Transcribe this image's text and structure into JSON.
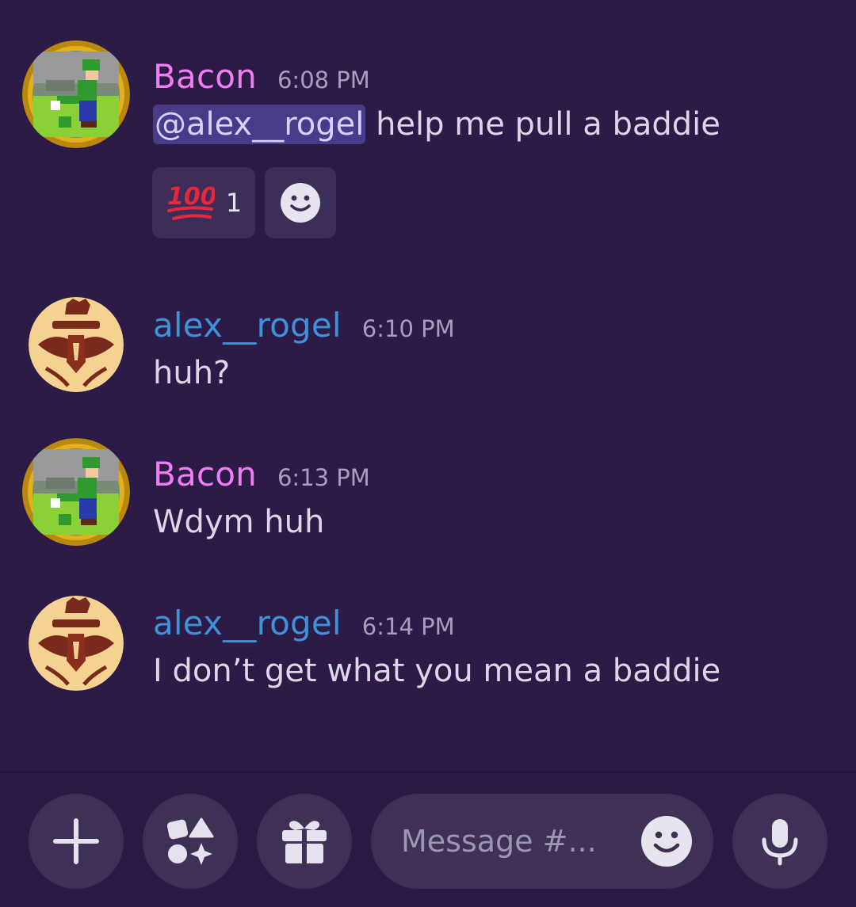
{
  "messages": [
    {
      "author": "Bacon",
      "author_color": "#f17df3",
      "time": "6:08 PM",
      "mention": "@alex__rogel",
      "text": " help me pull a baddie",
      "reactions": [
        {
          "emoji": "100-emoji",
          "count": "1"
        }
      ],
      "avatar": "luigi-avatar"
    },
    {
      "author": "alex__rogel",
      "author_color": "#3e92d9",
      "time": "6:10 PM",
      "text": "huh?",
      "avatar": "crest-avatar"
    },
    {
      "author": "Bacon",
      "author_color": "#f17df3",
      "time": "6:13 PM",
      "text": "Wdym huh",
      "avatar": "luigi-avatar"
    },
    {
      "author": "alex__rogel",
      "author_color": "#3e92d9",
      "time": "6:14 PM",
      "text": "I don’t get what you mean a baddie",
      "avatar": "crest-avatar"
    }
  ],
  "composer": {
    "placeholder": "Message #...",
    "buttons": [
      "plus-icon",
      "apps-icon",
      "gift-icon",
      "microphone-icon"
    ]
  },
  "colors": {
    "background": "#2c1b46",
    "button_bg": "#3f3055",
    "mention_bg": "#4a3a8a",
    "reaction_bg": "#3d2e59"
  }
}
